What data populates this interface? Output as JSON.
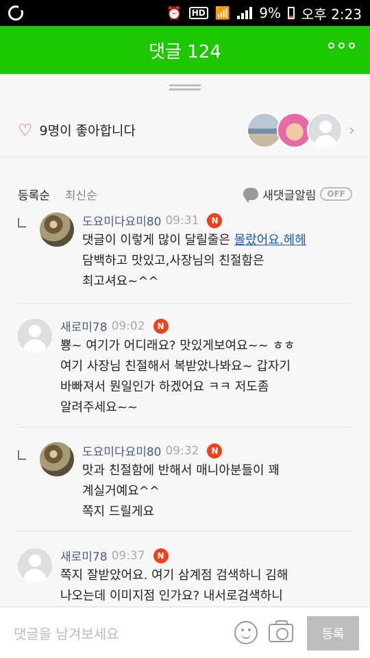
{
  "status_bar": {
    "battery": "9%",
    "time": "오후 2:23",
    "hd": "HD"
  },
  "header": {
    "title": "댓글 124"
  },
  "likes": {
    "text": "9명이 좋아합니다"
  },
  "sort": {
    "tab_registered": "등록순",
    "tab_latest": "최신순",
    "notify_label": "새댓글알림",
    "toggle_state": "OFF"
  },
  "comments": [
    {
      "author": "도요미다요미80",
      "time": "09:31",
      "badge": "N",
      "text_prefix": "댓글이 이렇게 많이 달릴줄은 ",
      "text_link": "몰랐어요.헤헤",
      "text_rest": "담백하고 맛있고,사장님의 친절함은\n최고셔요~^^"
    },
    {
      "author": "새로미78",
      "time": "09:02",
      "badge": "N",
      "text": "뿅~ 여기가 어디래요? 맛있게보여요~~ ㅎㅎ\n여기 사장님 친절해서 복받았나봐요~ 갑자기\n바빠져서 뭔일인가 하겠어요 ㅋㅋ 저도좀\n알려주세요~~"
    },
    {
      "author": "도요미다요미80",
      "time": "09:32",
      "badge": "N",
      "text": "맛과 친절함에 반해서 매니아분들이 꽤\n계실거예요^^\n쪽지 드릴게요"
    },
    {
      "author": "새로미78",
      "time": "09:37",
      "badge": "N",
      "text": "쪽지 잘받았어요. 여기 삼계점 검색하니 김해\n나오는데 이미지점 인가요? 내서로검색하니"
    }
  ],
  "input": {
    "placeholder": "댓글을 남겨보세요",
    "submit_label": "등록"
  },
  "colors": {
    "header_green": "#1ec800",
    "author_blue": "#4a5b8c",
    "badge_red": "#f2401c",
    "link_blue": "#1a55b8"
  }
}
